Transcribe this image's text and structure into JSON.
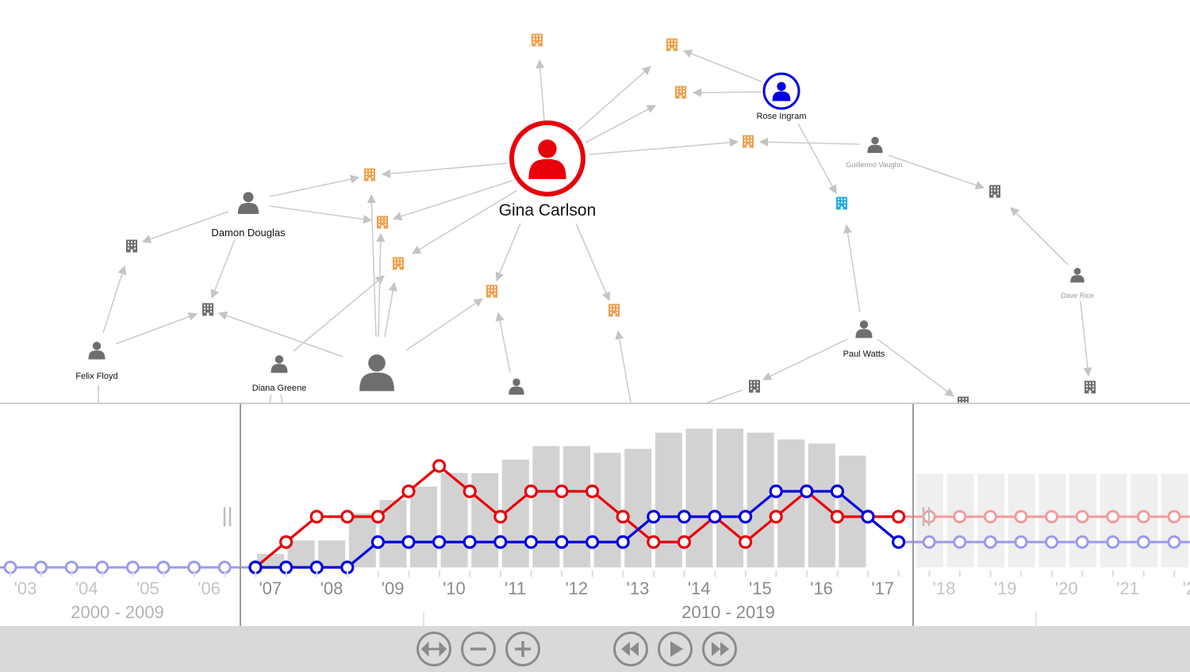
{
  "colors": {
    "accent_red": "#e8000b",
    "accent_blue": "#0000e0",
    "org_orange": "#f0a050",
    "org_blue": "#22aadd",
    "node_gray": "#6e6e6e",
    "bar_gray": "#d2d2d2"
  },
  "graph": {
    "people": [
      {
        "name": "Gina Carlson",
        "style": "focus-red"
      },
      {
        "name": "Rose Ingram",
        "style": "focus-blue"
      },
      {
        "name": "Guillermo Vaughn",
        "style": "faint"
      },
      {
        "name": "Damon Douglas",
        "style": "normal"
      },
      {
        "name": "Felix Floyd",
        "style": "normal"
      },
      {
        "name": "Diana Greene",
        "style": "normal"
      },
      {
        "name": "Paul Watts",
        "style": "normal"
      },
      {
        "name": "Dave Rice",
        "style": "faint"
      },
      {
        "name": "",
        "style": "large-unlabeled"
      },
      {
        "name": "",
        "style": "unlabeled"
      }
    ],
    "organization_icon": "building-icon",
    "person_icon": "person-icon"
  },
  "timeline": {
    "year_ticks": [
      "'03",
      "'04",
      "'05",
      "'06",
      "'07",
      "'08",
      "'09",
      "'10",
      "'11",
      "'12",
      "'13",
      "'14",
      "'15",
      "'16",
      "'17",
      "'18",
      "'19",
      "'20",
      "'21",
      "'2"
    ],
    "decades": [
      "2000 - 2009",
      "2010 - 2019"
    ],
    "chart_data": {
      "type": "bar+line",
      "bar_values": [
        1,
        2,
        2,
        4,
        5,
        6,
        7,
        7,
        8,
        9,
        9,
        8.5,
        8.8,
        10,
        10.3,
        10.3,
        10,
        9.5,
        9.2,
        8.3
      ],
      "bar_range_label": "2007 - 2017 (half-year bars)",
      "series": [
        {
          "color": "#e8000b",
          "values": [
            0,
            1,
            2,
            2,
            2,
            3,
            4,
            3,
            2,
            3,
            3,
            3,
            2,
            1,
            1,
            2,
            1,
            2,
            3,
            2,
            2,
            2
          ]
        },
        {
          "color": "#0000e0",
          "values": [
            0,
            0,
            0,
            0,
            1,
            1,
            1,
            1,
            1,
            1,
            1,
            1,
            1,
            2,
            2,
            2,
            2,
            3,
            3,
            3,
            2,
            1
          ]
        }
      ],
      "series_x_labels": [
        "'07",
        "",
        "'08",
        "",
        "'09",
        "",
        "'10",
        "",
        "'11",
        "",
        "'12",
        "",
        "'13",
        "",
        "'14",
        "",
        "'15",
        "",
        "'16",
        "",
        "'17",
        ""
      ]
    }
  },
  "controls": [
    {
      "name": "fit-button",
      "icon": "fit-arrows-icon"
    },
    {
      "name": "zoom-out-button",
      "icon": "minus-icon"
    },
    {
      "name": "zoom-in-button",
      "icon": "plus-icon"
    },
    {
      "name": "step-back-button",
      "icon": "rewind-icon"
    },
    {
      "name": "play-button",
      "icon": "play-icon"
    },
    {
      "name": "step-forward-button",
      "icon": "fast-forward-icon"
    }
  ]
}
